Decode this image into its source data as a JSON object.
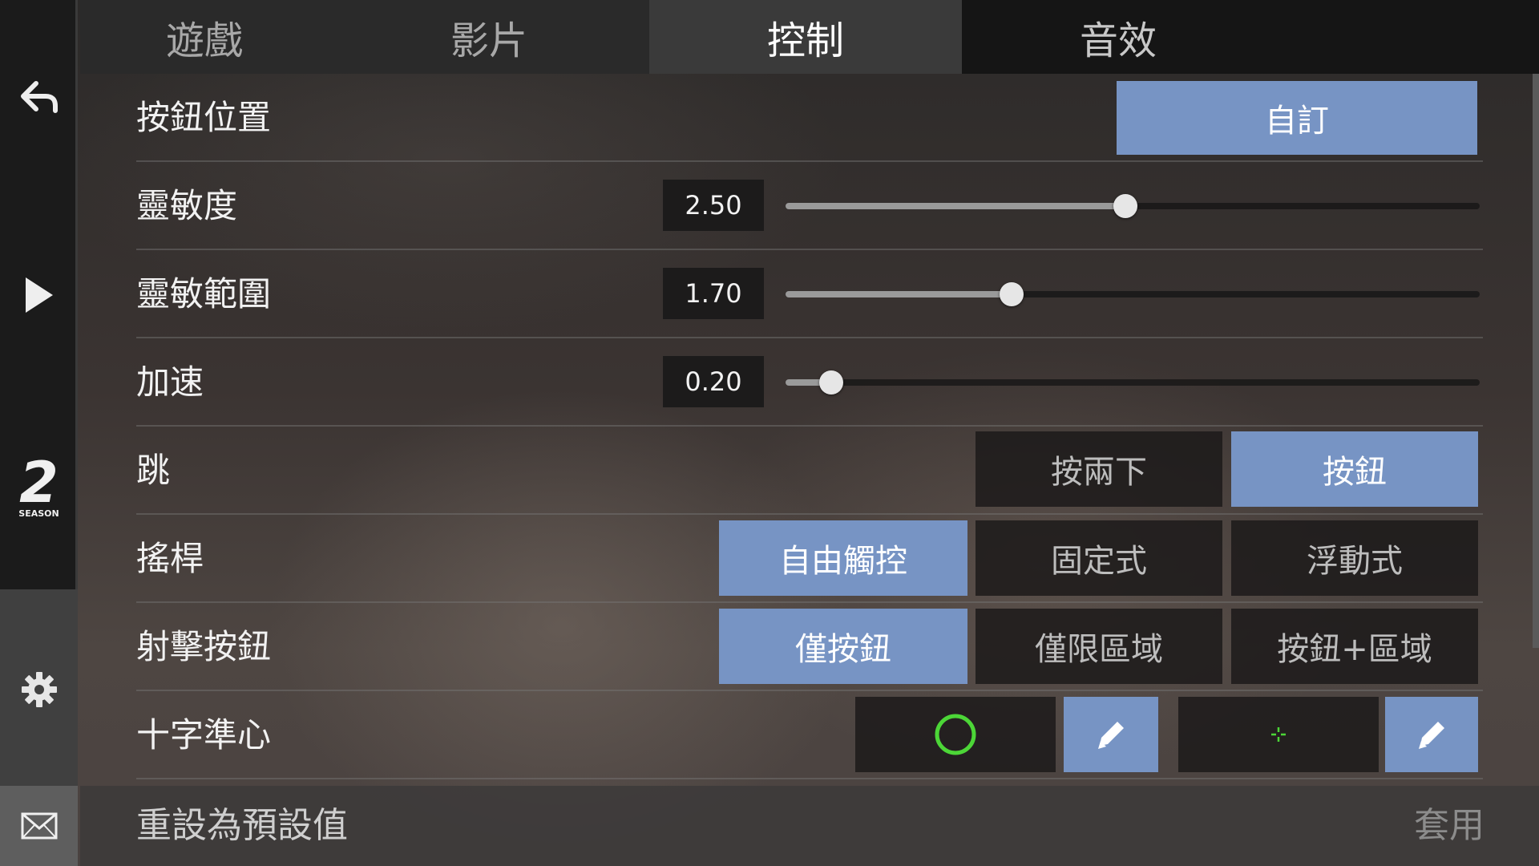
{
  "tabs": {
    "game": "遊戲",
    "video": "影片",
    "control": "控制",
    "audio": "音效"
  },
  "sidebar": {
    "back": "back-arrow-icon",
    "play": "play-icon",
    "season_number": "2",
    "season_label": "SEASON",
    "settings": "gear-icon",
    "mail": "mail-icon"
  },
  "settings": {
    "button_position": {
      "label": "按鈕位置",
      "value": "自訂"
    },
    "sensitivity": {
      "label": "靈敏度",
      "value": "2.50",
      "fraction": 0.49
    },
    "sensitivity_range": {
      "label": "靈敏範圍",
      "value": "1.70",
      "fraction": 0.326
    },
    "acceleration": {
      "label": "加速",
      "value": "0.20",
      "fraction": 0.066
    },
    "jump": {
      "label": "跳",
      "options": [
        "按兩下",
        "按鈕"
      ],
      "selected": "按鈕"
    },
    "joystick": {
      "label": "搖桿",
      "options": [
        "自由觸控",
        "固定式",
        "浮動式"
      ],
      "selected": "自由觸控"
    },
    "fire_button": {
      "label": "射擊按鈕",
      "options": [
        "僅按鈕",
        "僅限區域",
        "按鈕+區域"
      ],
      "selected": "僅按鈕"
    },
    "crosshair": {
      "label": "十字準心",
      "primary_icon": "circle-crosshair-icon",
      "secondary_icon": "small-cross-crosshair-icon",
      "edit_icon": "pencil-icon",
      "crosshair_color": "#4cd637"
    }
  },
  "footer": {
    "reset": "重設為預設值",
    "apply": "套用"
  },
  "colors": {
    "accent": "#7794c4",
    "sidebar": "#1b1b1b"
  }
}
